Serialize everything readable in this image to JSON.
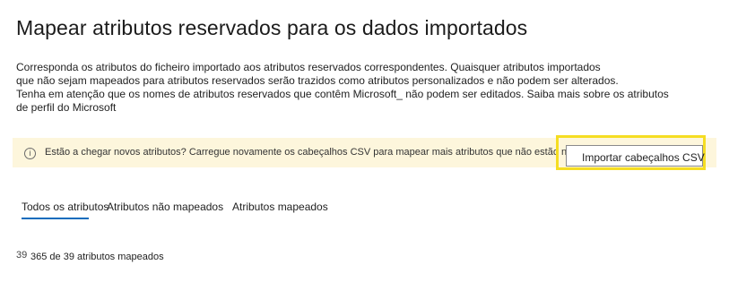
{
  "page": {
    "title": "Mapear atributos reservados para os dados importados"
  },
  "description": {
    "lines": [
      "Corresponda os atributos do ficheiro importado aos atributos reservados correspondentes. Quaisquer atributos importados",
      "que não sejam mapeados para atributos reservados serão trazidos como atributos personalizados e não podem ser alterados.",
      "Tenha em atenção que os nomes de atributos reservados que contêm Microsoft_ não podem ser editados. Saiba mais sobre os atributos",
      "de perfil do Microsoft"
    ]
  },
  "banner": {
    "icon": "info-icon",
    "icon_glyph": "i",
    "message": "Estão a chegar novos atributos? Carregue novamente os cabeçalhos CSV para mapear mais atributos que não estão na lista .",
    "button_label": "Importar cabeçalhos CSV",
    "background": "#fdf6dc",
    "highlight_color": "#f5dd22"
  },
  "tabs": [
    {
      "label": "Todos os atributos",
      "selected": true
    },
    {
      "label": "Atributos não mapeados",
      "selected": false
    },
    {
      "label": "Atributos mapeados",
      "selected": false
    }
  ],
  "tab_accent": "#0f6cbd",
  "summary": {
    "icon_text": "39",
    "text": "365 de 39 atributos mapeados"
  }
}
